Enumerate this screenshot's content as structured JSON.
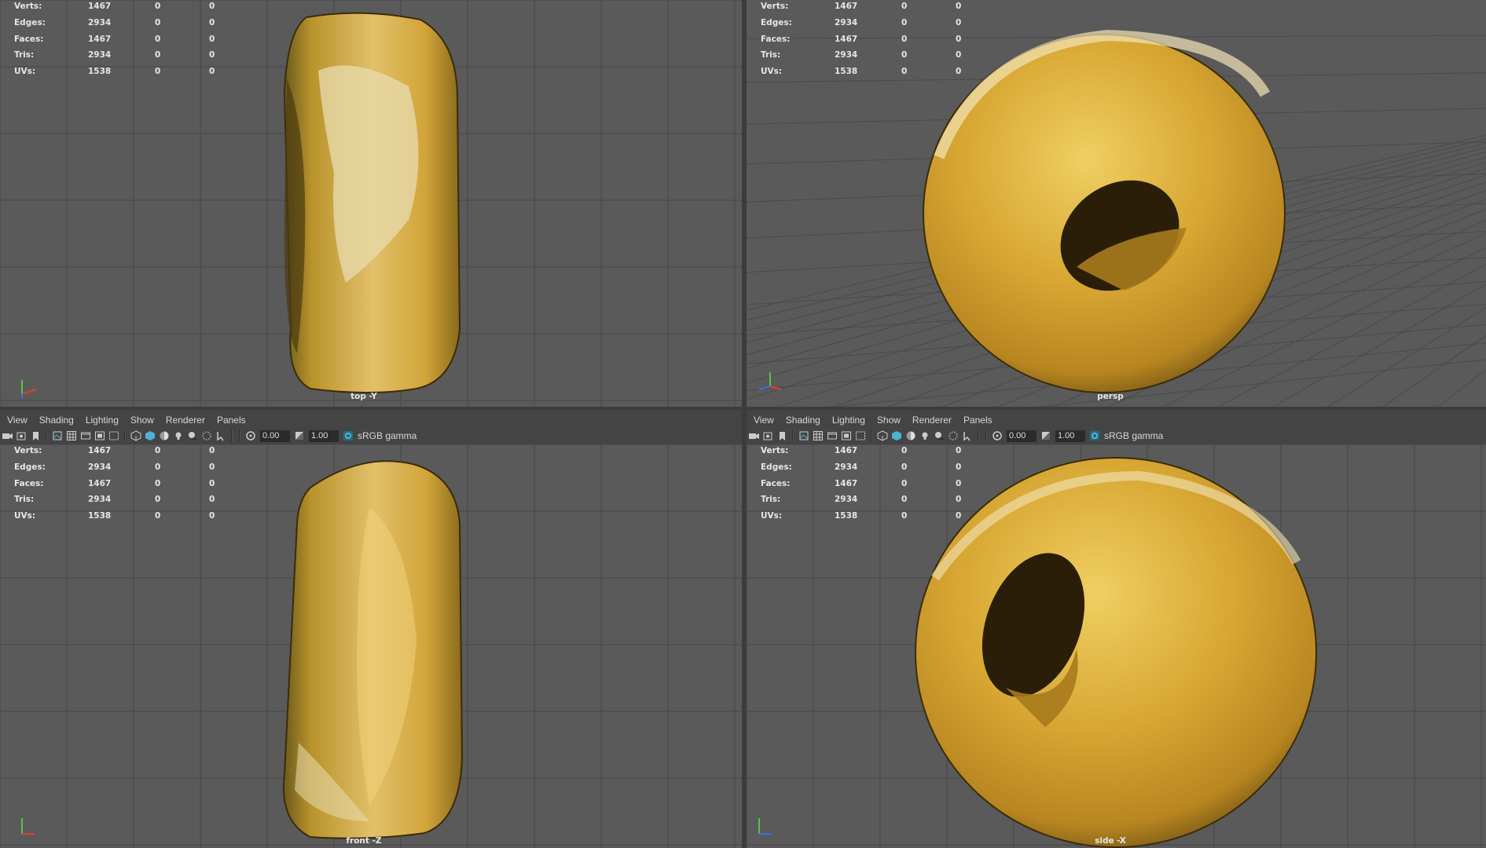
{
  "stats": {
    "labels": [
      "Verts:",
      "Edges:",
      "Faces:",
      "Tris:",
      "UVs:"
    ],
    "values": [
      [
        "1467",
        "0",
        "0"
      ],
      [
        "2934",
        "0",
        "0"
      ],
      [
        "1467",
        "0",
        "0"
      ],
      [
        "2934",
        "0",
        "0"
      ],
      [
        "1538",
        "0",
        "0"
      ]
    ]
  },
  "viewports": {
    "top_left": {
      "label": "top -Y"
    },
    "top_right": {
      "label": "persp"
    },
    "bottom_left": {
      "label": "front -Z"
    },
    "bottom_right": {
      "label": "side -X"
    }
  },
  "panel_menu": {
    "items": [
      "View",
      "Shading",
      "Lighting",
      "Show",
      "Renderer",
      "Panels"
    ]
  },
  "panel_toolbar": {
    "exposure_value": "0.00",
    "gamma_value": "1.00",
    "color_space": "sRGB gamma"
  },
  "icons": {
    "toolbar": [
      "camera-icon",
      "camera-attributes-icon",
      "bookmark-icon",
      "image-plane-icon",
      "grid-icon",
      "film-gate-icon",
      "resolution-gate-icon",
      "safe-action-icon",
      "wireframe-icon",
      "smooth-shade-icon",
      "textured-icon",
      "lights-icon",
      "shadows-icon",
      "xray-icon",
      "isolate-select-icon",
      "exposure-icon",
      "gamma-icon",
      "color-management-icon"
    ],
    "axis_gizmo": "axis-gizmo-icon"
  },
  "colors": {
    "viewport_bg": "#5a5a5a",
    "grid_line": "#444444",
    "axis_x": "#e0402f",
    "axis_y": "#56c24a",
    "axis_z": "#3a6fe0",
    "accent_icon": "#4db3d4",
    "bagel": "#d5a92f"
  }
}
